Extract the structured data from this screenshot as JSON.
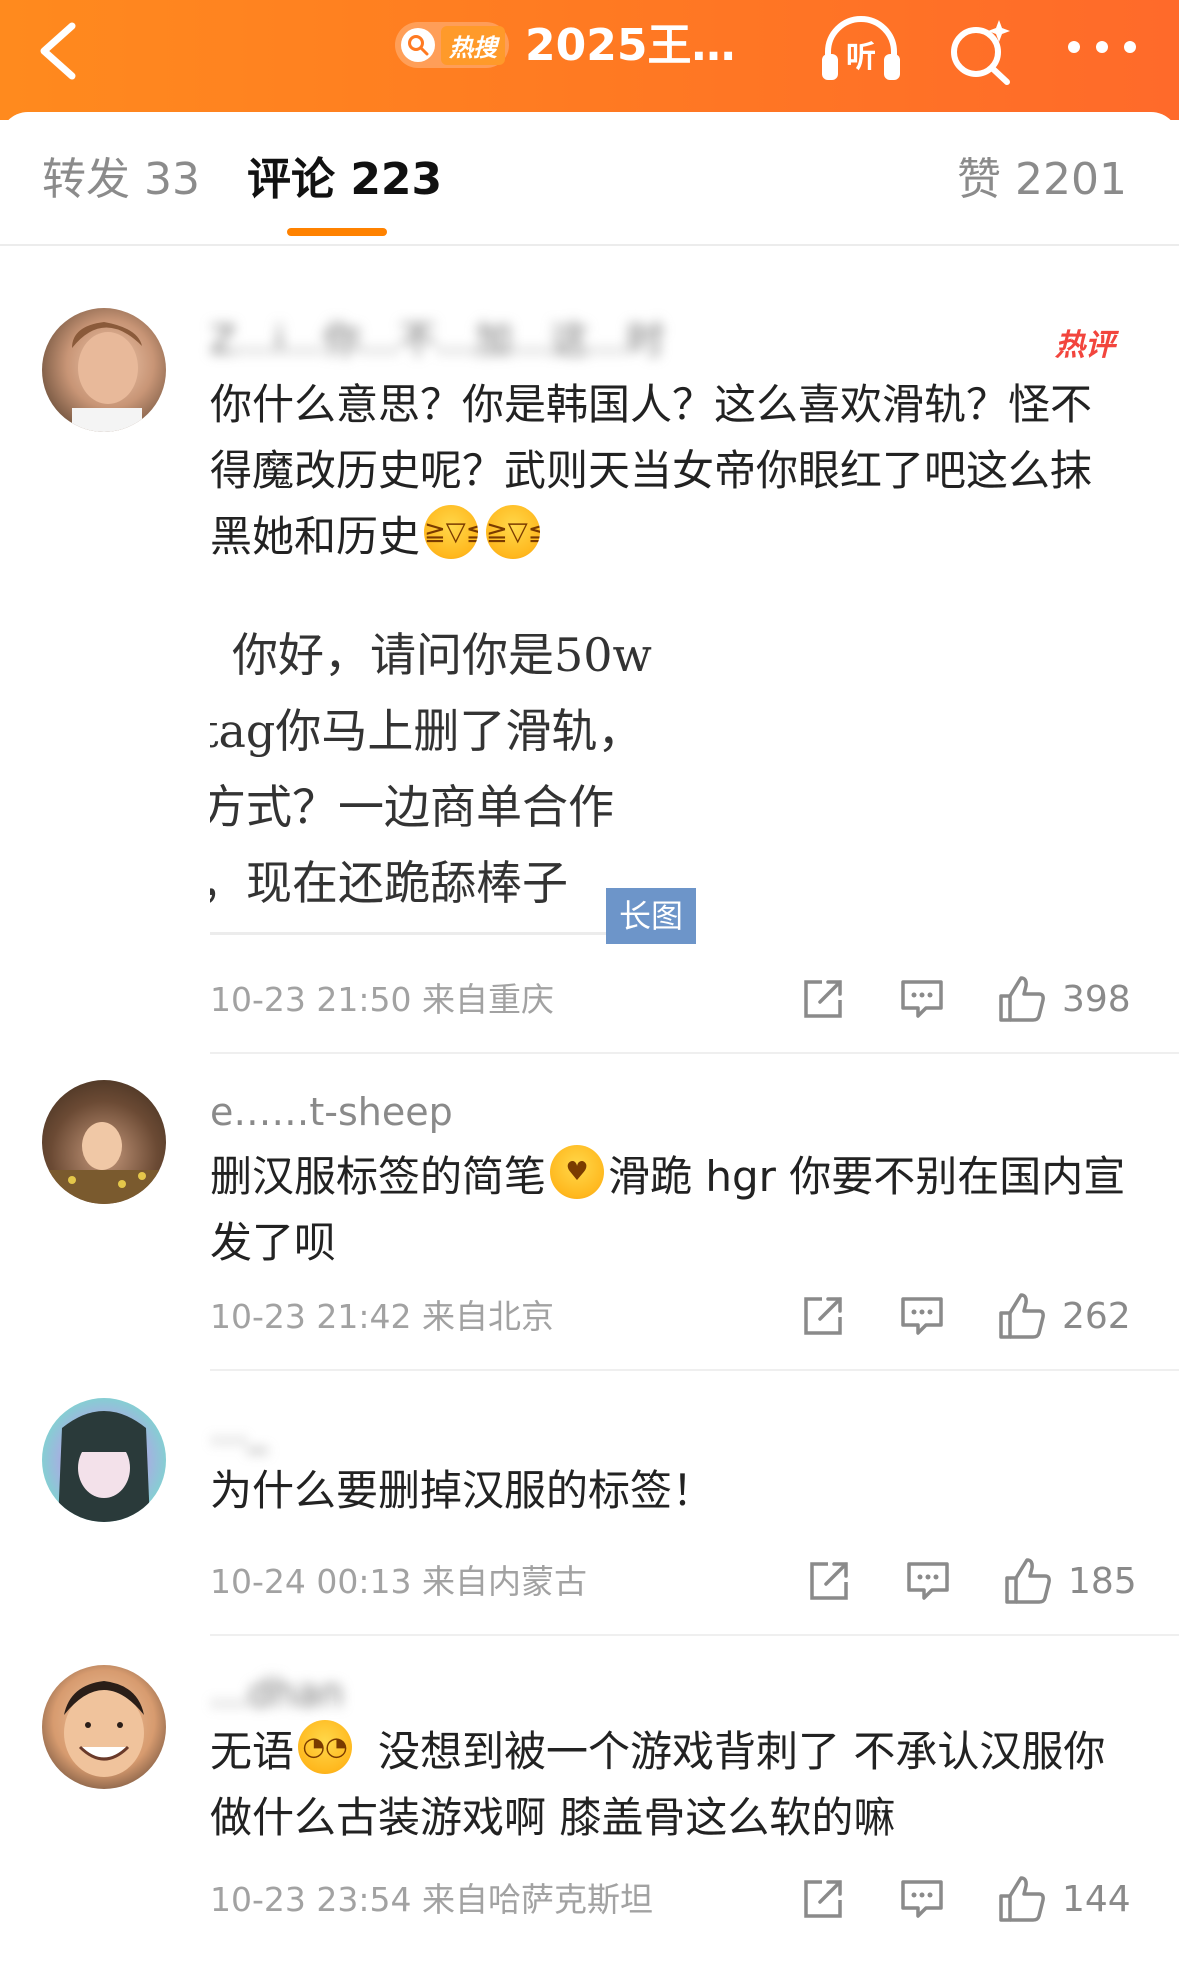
{
  "header": {
    "search_badge": "热搜",
    "topic_title": "2025王…",
    "listen_label": "听"
  },
  "tabs": [
    {
      "label": "转发 33"
    },
    {
      "label": "评论 223"
    },
    {
      "label": "赞 2201"
    }
  ],
  "comments": [
    {
      "username": "Z…ⅰ…你…不…加…这…时",
      "hot_badge": "热评",
      "text_before": "你什么意思？你是韩国人？这么喜欢滑轨？怪不得魔改历史呢？武则天当女帝你眼红了吧这么抹黑她和历史",
      "long_image_lines": [
        "你好，请问你是50w",
        "tag你马上删了滑轨，",
        "方式？一边商单合作",
        "，现在还跪舔棒子"
      ],
      "long_image_badge": "长图",
      "meta": "10-23 21:50 来自重庆",
      "likes": "398"
    },
    {
      "username": "e……t-sheep",
      "text_part1": "删汉服标签的简笔",
      "text_part2": "滑跪 hgr 你要不别在国内宣发了呗",
      "meta": "10-23 21:42 来自北京",
      "likes": "262"
    },
    {
      "username": "…_",
      "text": "为什么要删掉汉服的标签！",
      "meta": "10-24 00:13 来自内蒙古",
      "likes": "185"
    },
    {
      "username": "…dhan",
      "text_part1": "无语",
      "text_part2": "没想到被一个游戏背刺了 不承认汉服你做什么古装游戏啊 膝盖骨这么软的嘛",
      "meta": "10-23 23:54 来自哈萨克斯坦",
      "likes": "144"
    }
  ],
  "colors": {
    "brand_orange": "#ff8200",
    "hot_red": "#f2453d",
    "long_badge_blue": "#6d95c9"
  }
}
